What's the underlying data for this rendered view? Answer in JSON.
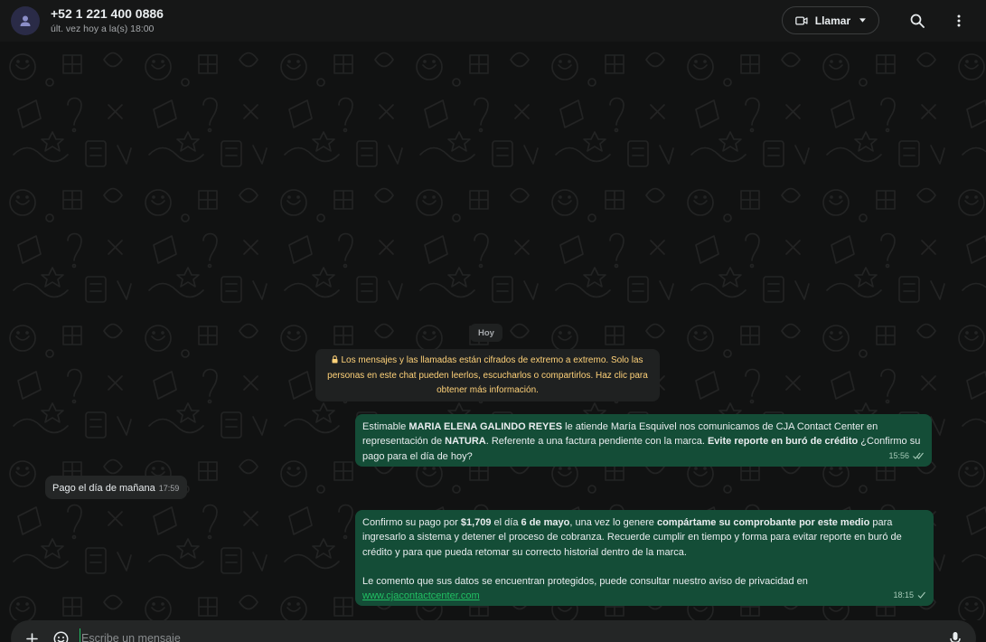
{
  "header": {
    "contact_name": "+52 1 221 400 0886",
    "last_seen": "últ. vez hoy a la(s) 18:00",
    "call_label": "Llamar",
    "icons": {
      "avatar": "person-icon",
      "video": "video-camera-icon",
      "dropdown": "chevron-down-icon",
      "search": "search-icon",
      "menu": "more-vertical-icon"
    }
  },
  "chat": {
    "date_label": "Hoy",
    "encryption_notice": "Los mensajes y las llamadas están cifrados de extremo a extremo. Solo las personas en este chat pueden leerlos, escucharlos o compartirlos. Haz clic para obtener más información.",
    "messages": [
      {
        "direction": "outgoing",
        "parts": {
          "t1": "Estimable ",
          "b1": "MARIA ELENA GALINDO REYES",
          "t2": " le atiende María Esquivel nos comunicamos de CJA Contact Center en representación de ",
          "b2": "NATURA",
          "t3": ". Referente a una factura pendiente con la marca. ",
          "b3": "Evite reporte en buró de crédito",
          "t4": " ¿Confirmo su pago para el día de hoy?"
        },
        "time": "15:56",
        "status": "read"
      },
      {
        "direction": "incoming",
        "text": "Pago el día de mañana",
        "time": "17:59"
      },
      {
        "direction": "outgoing",
        "parts": {
          "t1": "Confirmo su pago por ",
          "b1": "$1,709",
          "t2": " el día ",
          "b2": "6 de mayo",
          "t3": ", una vez lo genere ",
          "b3": "compártame su comprobante por este medio",
          "t4": " para ingresarlo a sistema y detener el proceso de cobranza. Recuerde cumplir en tiempo y forma para evitar reporte en buró de crédito y para que pueda retomar su correcto historial dentro de la marca.",
          "t5": "Le comento que sus datos se encuentran protegidos, puede consultar nuestro aviso de privacidad en",
          "link": "www.cjacontactcenter.com"
        },
        "time": "18:15",
        "status": "sent"
      }
    ]
  },
  "composer": {
    "placeholder": "Escribe un mensaje",
    "value": "",
    "icons": {
      "attach": "plus-icon",
      "emoji": "emoji-icon",
      "mic": "microphone-icon"
    }
  },
  "colors": {
    "background": "#161717",
    "outgoing_bubble": "#144d37",
    "incoming_bubble": "#242626",
    "accent": "#21c063",
    "encryption_text": "#ffd279"
  }
}
